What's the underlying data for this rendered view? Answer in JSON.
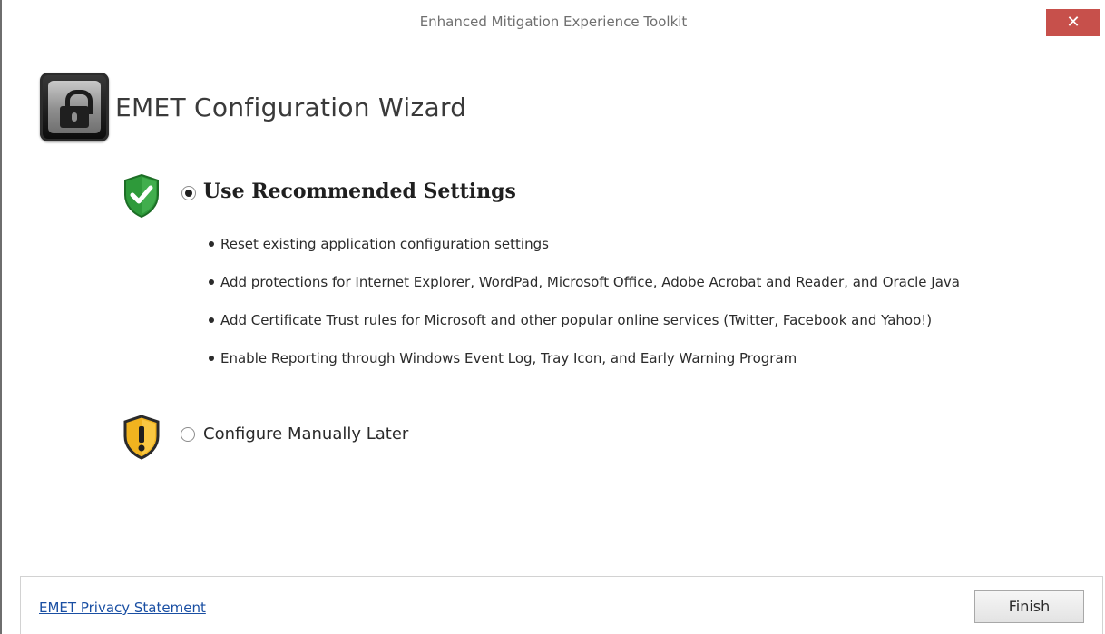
{
  "window": {
    "title": "Enhanced Mitigation Experience Toolkit",
    "close_glyph": "✕"
  },
  "wizard": {
    "heading": "EMET Configuration Wizard",
    "logo_icon": "padlock-icon"
  },
  "options": {
    "recommended": {
      "label": "Use Recommended Settings",
      "selected": true,
      "icon": "green-check-shield-icon",
      "bullets": [
        "Reset existing application configuration settings",
        "Add protections for Internet Explorer, WordPad, Microsoft Office, Adobe Acrobat and Reader, and Oracle Java",
        "Add Certificate Trust rules for Microsoft and other popular online services (Twitter, Facebook and Yahoo!)",
        "Enable Reporting through Windows Event Log, Tray Icon, and Early Warning Program"
      ]
    },
    "manual": {
      "label": "Configure Manually Later",
      "selected": false,
      "icon": "warning-shield-icon"
    }
  },
  "footer": {
    "privacy_link": "EMET Privacy Statement",
    "finish_label": "Finish"
  },
  "colors": {
    "close_button": "#c7504b",
    "link": "#1a4fa3",
    "shield_green": "#2e9a3a",
    "shield_amber": "#f0b31f"
  }
}
